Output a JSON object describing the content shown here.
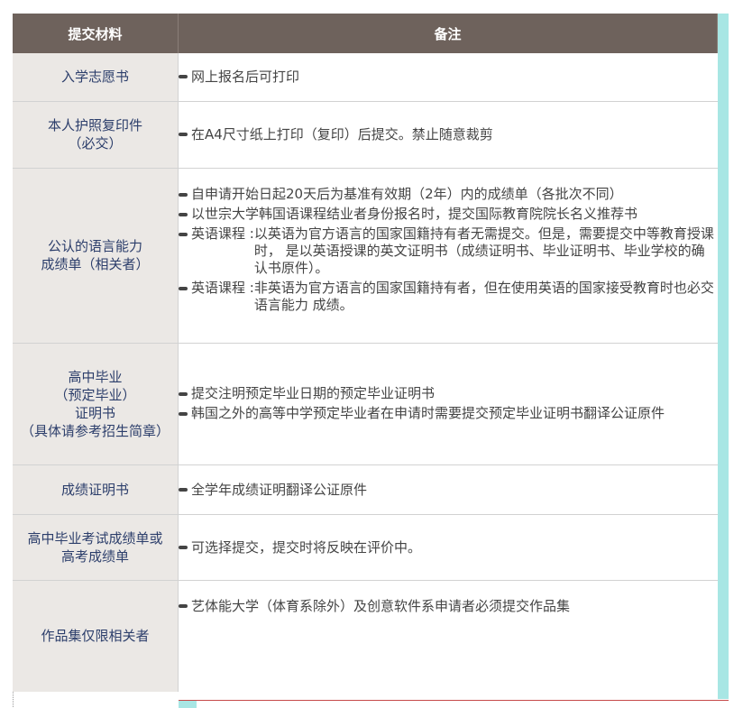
{
  "header": {
    "col1": "提交材料",
    "col2": "备注"
  },
  "rows": [
    {
      "label": [
        "入学志愿书"
      ],
      "notes": [
        {
          "text": "网上报名后可打印"
        }
      ]
    },
    {
      "label": [
        "本人护照复印件",
        "（必交）"
      ],
      "notes": [
        {
          "text": "在A4尺寸纸上打印（复印）后提交。禁止随意裁剪"
        }
      ]
    },
    {
      "label": [
        "公认的语言能力",
        "成绩单（相关者）"
      ],
      "notes": [
        {
          "text": "自申请开始日起20天后为基准有效期（2年）内的成绩单（各批次不同）"
        },
        {
          "text": "以世宗大学韩国语课程结业者身份报名时，提交国际教育院院长名义推荐书"
        },
        {
          "prefix": "英语课程 : ",
          "text": "以英语为官方语言的国家国籍持有者无需提交。但是，需要提交中等教育授课时，  是以英语授课的英文证明书（成绩证明书、毕业证明书、毕业学校的确认书原件）。"
        },
        {
          "prefix": "英语课程 : ",
          "text": "非英语为官方语言的国家国籍持有者，但在使用英语的国家接受教育时也必交语言能力 成绩。"
        }
      ]
    },
    {
      "label": [
        "高中毕业",
        "（预定毕业）",
        "证明书",
        "（具体请参考招生简章）"
      ],
      "notes": [
        {
          "text": "提交注明预定毕业日期的预定毕业证明书"
        },
        {
          "text": "韩国之外的高等中学预定毕业者在申请时需要提交预定毕业证明书翻译公证原件"
        }
      ]
    },
    {
      "label": [
        "成绩证明书"
      ],
      "notes": [
        {
          "text": "全学年成绩证明翻译公证原件"
        }
      ]
    },
    {
      "label": [
        "高中毕业考试成绩单或",
        "高考成绩单"
      ],
      "notes": [
        {
          "text": "可选择提交，提交时将反映在评价中。"
        }
      ]
    },
    {
      "label": [
        "作品集仅限相关者"
      ],
      "notes": [
        {
          "text": "艺体能大学（体育系除外）及创意软件系申请者必须提交作品集"
        }
      ]
    }
  ],
  "colors": {
    "header_bg": "#6e625c",
    "label_bg": "#ebe8e5",
    "label_text": "#2c3e6b",
    "accent": "#a8e6e4"
  }
}
